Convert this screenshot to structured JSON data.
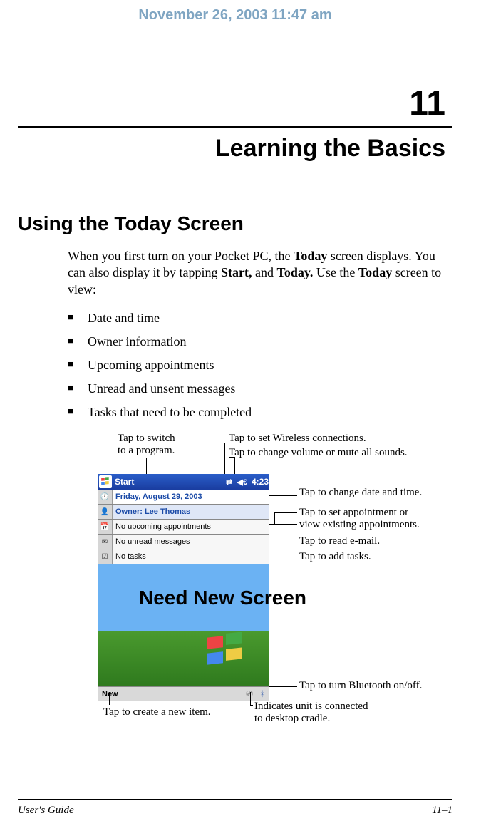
{
  "header": {
    "timestamp": "November 26, 2003 11:47 am"
  },
  "chapter": {
    "number": "11",
    "title": "Learning the Basics"
  },
  "section": {
    "heading": "Using the Today Screen"
  },
  "intro": {
    "p1a": "When you first turn on your Pocket PC, the ",
    "b1": "Today",
    "p1b": " screen displays. You can also display it by tapping ",
    "b2": "Start,",
    "p1c": " and ",
    "b3": "Today.",
    "p1d": " Use the ",
    "b4": "Today",
    "p1e": " screen to view:"
  },
  "bullets": [
    "Date and time",
    "Owner information",
    "Upcoming appointments",
    "Unread and unsent messages",
    "Tasks that need to be completed"
  ],
  "callouts": {
    "switch_program_l1": "Tap to switch",
    "switch_program_l2": "to a program.",
    "wireless": "Tap to set Wireless connections.",
    "volume": "Tap to change volume or mute all sounds.",
    "date": "Tap to change date and time.",
    "appt_l1": "Tap to set appointment or",
    "appt_l2": "view existing appointments.",
    "email": "Tap to read e-mail.",
    "tasks": "Tap to add tasks.",
    "bluetooth": "Tap to turn Bluetooth on/off.",
    "cradle_l1": "Indicates unit is connected",
    "cradle_l2": "to desktop cradle.",
    "newitem": "Tap to create a new item."
  },
  "device": {
    "start": "Start",
    "time": "4:23",
    "date_row": "Friday, August 29, 2003",
    "owner_row": "Owner: Lee Thomas",
    "appt_row": "No upcoming appointments",
    "msg_row": "No unread messages",
    "task_row": "No tasks",
    "new_label": "New"
  },
  "overlay": {
    "need_new_screen": "Need New Screen"
  },
  "footer": {
    "left": "User's Guide",
    "right": "11–1"
  }
}
